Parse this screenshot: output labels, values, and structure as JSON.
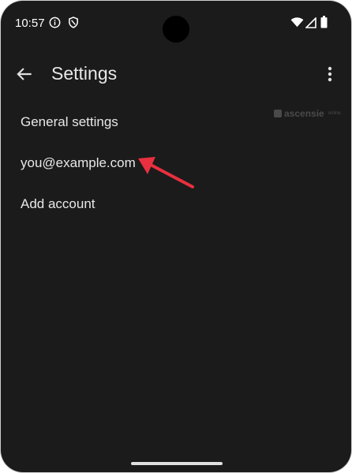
{
  "status_bar": {
    "time": "10:57",
    "left_icons": [
      "info-icon",
      "shield-icon"
    ],
    "right_icons": [
      "wifi-icon",
      "cell-signal-icon",
      "battery-icon"
    ]
  },
  "app_bar": {
    "title": "Settings",
    "back_icon": "arrow-left-icon",
    "more_icon": "more-vert-icon"
  },
  "menu": {
    "items": [
      {
        "label": "General settings"
      },
      {
        "label": "you@example.com"
      },
      {
        "label": "Add account"
      }
    ]
  },
  "watermark": {
    "text": "ascensie",
    "suffix": "online"
  },
  "annotation": {
    "color": "#e8303f",
    "points_to": "you@example.com"
  },
  "colors": {
    "background": "#1b1b1b",
    "text": "#e8e8e8"
  }
}
